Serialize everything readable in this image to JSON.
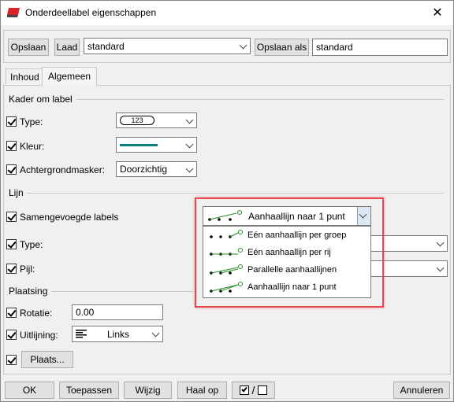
{
  "window": {
    "title": "Onderdeellabel eigenschappen",
    "close_glyph": "✕"
  },
  "toolbar": {
    "save_label": "Opslaan",
    "load_label": "Laad",
    "preset_value": "standard",
    "save_as_label": "Opslaan als",
    "save_as_value": "standard"
  },
  "tabs": [
    {
      "label": "Inhoud"
    },
    {
      "label": "Algemeen"
    }
  ],
  "kader": {
    "title": "Kader om label",
    "type_label": "Type:",
    "type_value": "123",
    "kleur_label": "Kleur:",
    "kleur_color": "#0e8080",
    "mask_label": "Achtergrondmasker:",
    "mask_value": "Doorzichtig"
  },
  "lijn": {
    "title": "Lijn",
    "merged_label": "Samengevoegde labels",
    "merged_value": "Aanhaallijn naar 1 punt",
    "type_label": "Type:",
    "pijl_label": "Pijl:",
    "options": [
      {
        "label": "Eén aanhaallijn per groep"
      },
      {
        "label": "Eén aanhaallijn per rij"
      },
      {
        "label": "Parallelle aanhaallijnen"
      },
      {
        "label": "Aanhaallijn naar 1 punt"
      }
    ]
  },
  "plaatsing": {
    "title": "Plaatsing",
    "rotatie_label": "Rotatie:",
    "rotatie_value": "0.00",
    "uitlijning_label": "Uitlijning:",
    "uitlijning_value": "Links",
    "plaats_label": "Plaats..."
  },
  "footer": {
    "ok_label": "OK",
    "apply_label": "Toepassen",
    "modify_label": "Wijzig",
    "get_label": "Haal op",
    "toggle_sep": "/",
    "cancel_label": "Annuleren"
  },
  "colors": {
    "highlight": "#e8474d",
    "leader_green": "#2a8a2a"
  }
}
